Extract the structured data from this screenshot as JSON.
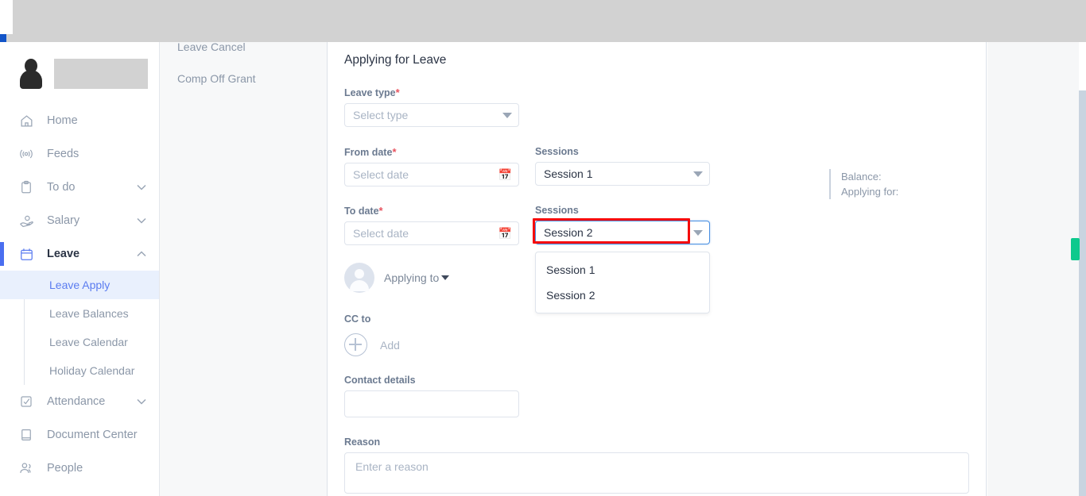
{
  "topbar": {
    "accent_color": "#1254c8",
    "placeholder_color": "#d2d2d2"
  },
  "sidebar": {
    "profile": {
      "name_placeholder": ""
    },
    "items": [
      {
        "label": "Home",
        "icon": "home-icon",
        "expandable": false
      },
      {
        "label": "Feeds",
        "icon": "broadcast-icon",
        "expandable": false
      },
      {
        "label": "To do",
        "icon": "clipboard-icon",
        "expandable": true,
        "chevron": "⌄"
      },
      {
        "label": "Salary",
        "icon": "hand-coin-icon",
        "expandable": true,
        "chevron": "⌄"
      },
      {
        "label": "Leave",
        "icon": "calendar-icon",
        "expandable": true,
        "chevron": "⌃",
        "active": true
      },
      {
        "label": "Attendance",
        "icon": "checkbox-icon",
        "expandable": true,
        "chevron": "⌄"
      },
      {
        "label": "Document Center",
        "icon": "book-icon",
        "expandable": false
      },
      {
        "label": "People",
        "icon": "people-icon",
        "expandable": false
      }
    ],
    "leave_submenu": [
      {
        "label": "Leave Apply",
        "selected": true
      },
      {
        "label": "Leave Balances",
        "selected": false
      },
      {
        "label": "Leave Calendar",
        "selected": false
      },
      {
        "label": "Holiday Calendar",
        "selected": false
      }
    ]
  },
  "secondary_nav": {
    "items": [
      {
        "label": "Leave Cancel",
        "clipped": true
      },
      {
        "label": "Comp Off Grant",
        "clipped": false
      }
    ]
  },
  "form": {
    "title": "Applying for Leave",
    "leave_type": {
      "label": "Leave type",
      "required": true,
      "placeholder": "Select type",
      "value": ""
    },
    "from_date": {
      "label": "From date",
      "required": true,
      "placeholder": "Select date",
      "value": "",
      "icon": "calendar-icon"
    },
    "from_sessions": {
      "label": "Sessions",
      "value": "Session 1"
    },
    "to_date": {
      "label": "To date",
      "required": true,
      "placeholder": "Select date",
      "value": "",
      "icon": "calendar-icon"
    },
    "to_sessions": {
      "label": "Sessions",
      "value": "Session 2",
      "focused": true,
      "highlight_color": "#f50b0b",
      "open": true,
      "options": [
        "Session 1",
        "Session 2"
      ]
    },
    "applying_to": {
      "label": "Applying to",
      "avatar": "person-avatar"
    },
    "cc_to": {
      "label": "CC to",
      "add_label": "Add",
      "icon": "plus-circle-icon"
    },
    "contact_details": {
      "label": "Contact details",
      "value": ""
    },
    "reason": {
      "label": "Reason",
      "placeholder": "Enter a reason",
      "value": ""
    },
    "required_marker": "*"
  },
  "balance": {
    "balance_label": "Balance:",
    "applying_for_label": "Applying for:"
  },
  "right_rail": {
    "tab_color": "#0ec98d"
  }
}
